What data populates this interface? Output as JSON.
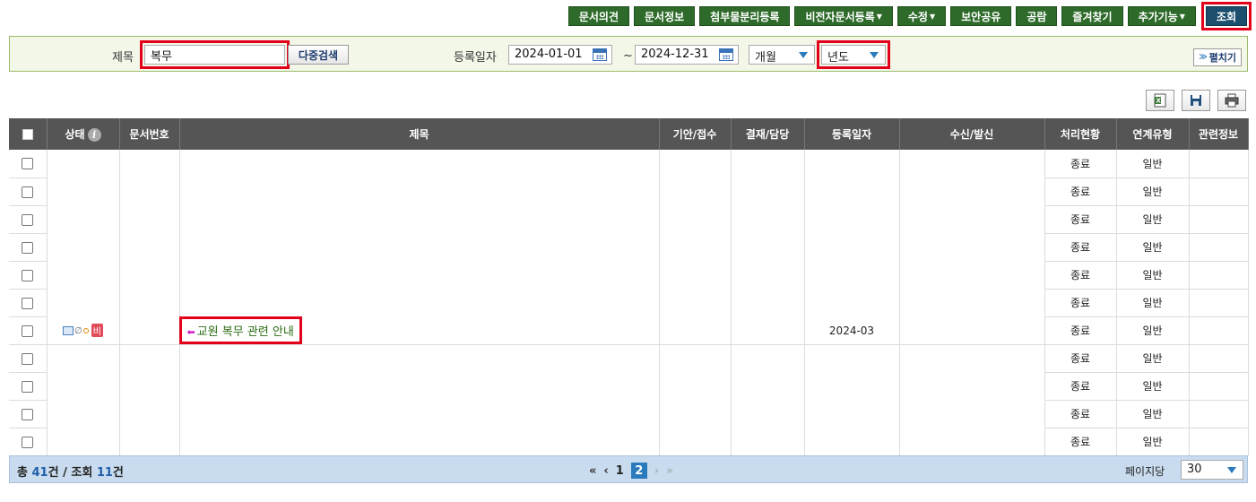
{
  "toolbar": {
    "buttons": [
      {
        "label": "문서의견"
      },
      {
        "label": "문서정보"
      },
      {
        "label": "첨부물분리등록"
      },
      {
        "label": "비전자문서등록"
      },
      {
        "label": "수정"
      },
      {
        "label": "보안공유"
      },
      {
        "label": "공람"
      },
      {
        "label": "즐겨찾기"
      },
      {
        "label": "추가기능"
      },
      {
        "label": "조회"
      }
    ]
  },
  "search": {
    "title_label": "제목",
    "title_value": "복무",
    "multi_search_label": "다중검색",
    "date_label": "등록일자",
    "date_from": "2024-01-01",
    "date_to": "2024-12-31",
    "date_sep": "~",
    "period_select": "개월",
    "unit_select": "년도",
    "expand_label": "펼치기"
  },
  "table": {
    "headers": [
      "상태",
      "문서번호",
      "제목",
      "기안/접수",
      "결재/담당",
      "등록일자",
      "수신/발신",
      "처리현황",
      "연계유형",
      "관련정보"
    ],
    "status_badge": "비",
    "rows": [
      {
        "title": "",
        "date": "",
        "status": "종료",
        "type": "일반"
      },
      {
        "title": "",
        "date": "",
        "status": "종료",
        "type": "일반"
      },
      {
        "title": "",
        "date": "",
        "status": "종료",
        "type": "일반"
      },
      {
        "title": "",
        "date": "",
        "status": "종료",
        "type": "일반"
      },
      {
        "title": "",
        "date": "",
        "status": "종료",
        "type": "일반"
      },
      {
        "title": "",
        "date": "",
        "status": "종료",
        "type": "일반"
      },
      {
        "title": "교원 복무 관련 안내",
        "date": "2024-03",
        "status": "종료",
        "type": "일반"
      },
      {
        "title": "",
        "date": "",
        "status": "종료",
        "type": "일반"
      },
      {
        "title": "",
        "date": "",
        "status": "종료",
        "type": "일반"
      },
      {
        "title": "",
        "date": "",
        "status": "종료",
        "type": "일반"
      },
      {
        "title": "",
        "date": "",
        "status": "종료",
        "type": "일반"
      }
    ]
  },
  "footer": {
    "total_prefix": "총",
    "total_count": "41",
    "total_unit": "건 / 조회",
    "view_count": "11",
    "view_unit": "건",
    "pages": [
      "1",
      "2"
    ],
    "per_page_label": "페이지당",
    "per_page_value": "30"
  },
  "colors": {
    "toolbar_green": "#2e6b2a",
    "primary_navy": "#1c4e6e",
    "highlight_red": "#e3001b",
    "header_grey": "#555555",
    "footer_blue": "#c9dcef",
    "link_green": "#2b6b12"
  }
}
